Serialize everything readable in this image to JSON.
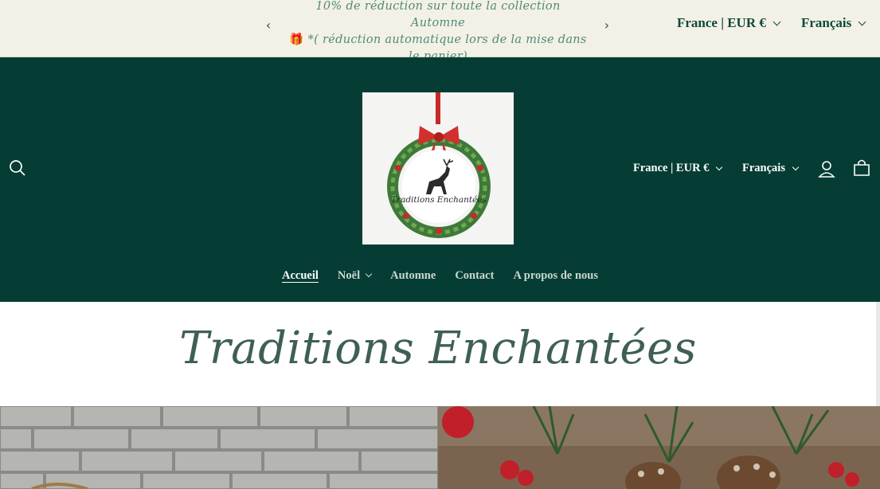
{
  "announcement": {
    "line1": "10% de réduction sur toute la collection Automne",
    "line2_icon": "gift-icon",
    "line2": "*( réduction automatique lors de la mise dans",
    "line3": "le panier)",
    "prev_icon": "chevron-left-icon",
    "next_icon": "chevron-right-icon",
    "country": "France | EUR €",
    "language": "Français"
  },
  "header": {
    "logo_text": "Traditions Enchantées",
    "country": "France | EUR €",
    "language": "Français",
    "icons": [
      "search-icon",
      "account-icon",
      "cart-icon"
    ]
  },
  "nav": {
    "items": [
      {
        "label": "Accueil"
      },
      {
        "label": "Noël"
      },
      {
        "label": "Automne"
      },
      {
        "label": "Contact"
      },
      {
        "label": "A propos de nous"
      }
    ]
  },
  "hero": {
    "title": "Traditions Enchantées"
  },
  "colors": {
    "announcement_bg": "#f3f1e6",
    "header_bg": "#053d34",
    "title": "#3f5f55",
    "accent_green": "#4f8a78"
  }
}
